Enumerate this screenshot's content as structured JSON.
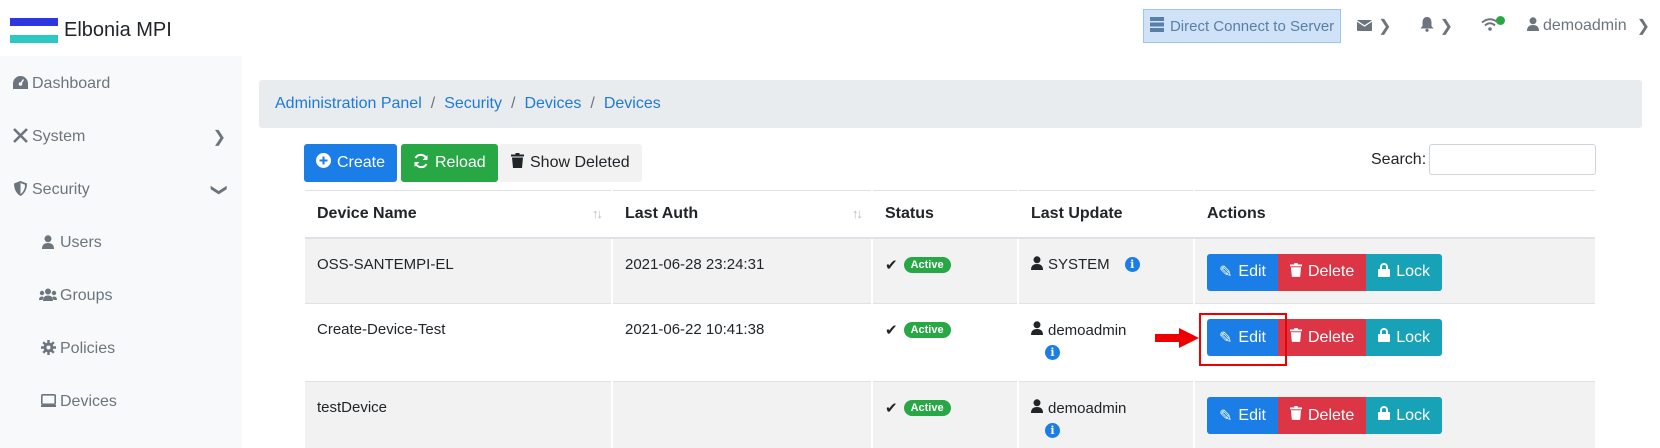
{
  "app": {
    "title": "Elbonia MPI",
    "flag_colors": [
      "#2d36e0",
      "#ffffff",
      "#2cc9c4"
    ]
  },
  "topnav": {
    "direct_connect": "Direct Connect to Server",
    "user": "demoadmin",
    "icons": [
      "server-icon",
      "envelope-icon",
      "bell-icon",
      "wifi-icon",
      "user-icon"
    ]
  },
  "sidebar": {
    "items": [
      {
        "label": "Dashboard",
        "icon": "dashboard-icon"
      },
      {
        "label": "System",
        "icon": "tools-icon",
        "expanded": false
      },
      {
        "label": "Security",
        "icon": "shield-icon",
        "expanded": true
      }
    ],
    "subitems": [
      {
        "label": "Users",
        "icon": "user-icon"
      },
      {
        "label": "Groups",
        "icon": "users-icon"
      },
      {
        "label": "Policies",
        "icon": "cog-icon"
      },
      {
        "label": "Devices",
        "icon": "tablet-icon"
      }
    ]
  },
  "breadcrumb": [
    "Administration Panel",
    "Security",
    "Devices",
    "Devices"
  ],
  "toolbar": {
    "create": "Create",
    "reload": "Reload",
    "show_deleted": "Show Deleted",
    "search_label": "Search:",
    "search_value": ""
  },
  "table": {
    "headers": [
      "Device Name",
      "Last Auth",
      "Status",
      "Last Update",
      "Actions"
    ],
    "rows": [
      {
        "name": "OSS-SANTEMPI-EL",
        "last_auth": "2021-06-28 23:24:31",
        "status": "Active",
        "updated_by": "SYSTEM"
      },
      {
        "name": "Create-Device-Test",
        "last_auth": "2021-06-22 10:41:38",
        "status": "Active",
        "updated_by": "demoadmin"
      },
      {
        "name": "testDevice",
        "last_auth": "",
        "status": "Active",
        "updated_by": "demoadmin"
      }
    ],
    "actions": {
      "edit": "Edit",
      "delete": "Delete",
      "lock": "Lock"
    }
  },
  "colors": {
    "primary": "#1a7ee6",
    "success": "#28a745",
    "danger": "#dc3545",
    "info": "#17a2b8",
    "highlight": "#e00000"
  }
}
